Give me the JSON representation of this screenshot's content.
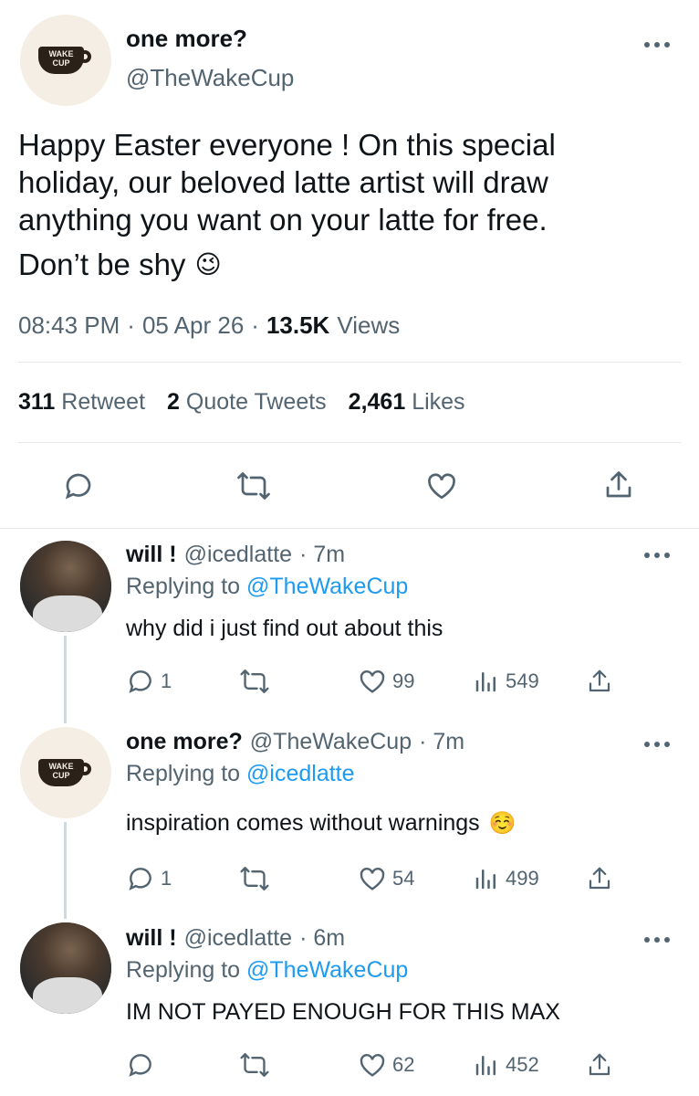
{
  "main_tweet": {
    "display_name": "one more?",
    "handle": "@TheWakeCup",
    "logo_text_1": "WAKE",
    "logo_text_2": "CUP",
    "text_line1": "Happy Easter everyone ! On this special",
    "text_line2": "holiday, our beloved latte artist will draw",
    "text_line3": "anything you want on your latte for free.",
    "text_line4": "Don’t be shy",
    "emoji_wink": "😉",
    "time": "08:43 PM",
    "sep1": "·",
    "date": "05 Apr 26",
    "sep2": "·",
    "views_count": "13.5K",
    "views_label": "Views",
    "retweets_count": "311",
    "retweets_label": "Retweet",
    "quotes_count": "2",
    "quotes_label": "Quote Tweets",
    "likes_count": "2,461",
    "likes_label": "Likes"
  },
  "replies": [
    {
      "display_name": "will !",
      "handle": "@icedlatte",
      "time": "· 7m",
      "replying_prefix": "Replying to",
      "replying_to": "@TheWakeCup",
      "text": "why did i just find out about this",
      "replies": "1",
      "likes": "99",
      "views": "549"
    },
    {
      "display_name": "one more?",
      "handle": "@TheWakeCup",
      "time": "· 7m",
      "replying_prefix": "Replying to",
      "replying_to": "@icedlatte",
      "text": "inspiration comes without warnings",
      "emoji": "☺️",
      "replies": "1",
      "likes": "54",
      "views": "499"
    },
    {
      "display_name": "will !",
      "handle": "@icedlatte",
      "time": "· 6m",
      "replying_prefix": "Replying to",
      "replying_to": "@TheWakeCup",
      "text": "IM NOT PAYED ENOUGH FOR THIS MAX",
      "replies": "",
      "likes": "62",
      "views": "452"
    }
  ]
}
